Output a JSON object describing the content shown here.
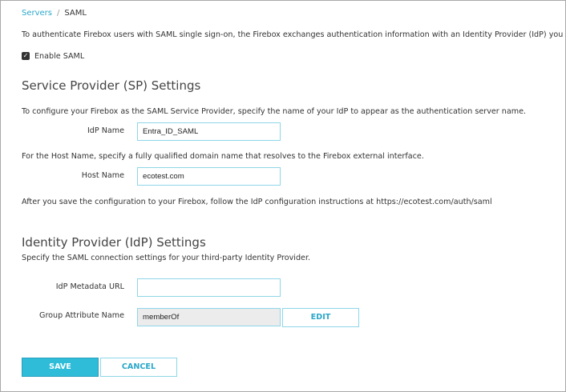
{
  "breadcrumb": {
    "parent": "Servers",
    "separator": "/",
    "current": "SAML"
  },
  "intro": "To authenticate Firebox users with SAML single sign-on, the Firebox exchanges authentication information with an Identity Provider (IdP) you specify.",
  "enable_saml": {
    "label": "Enable SAML",
    "checked": true
  },
  "sp": {
    "title": "Service Provider (SP) Settings",
    "desc": "To configure your Firebox as the SAML Service Provider, specify the name of your IdP to appear as the authentication server name.",
    "idp_name_label": "IdP Name",
    "idp_name_value": "Entra_ID_SAML",
    "host_desc": "For the Host Name, specify a fully qualified domain name that resolves to the Firebox external interface.",
    "host_label": "Host Name",
    "host_value": "ecotest.com",
    "after_save": "After you save the configuration to your Firebox, follow the IdP configuration instructions at https://ecotest.com/auth/saml"
  },
  "idp": {
    "title": "Identity Provider (IdP) Settings",
    "desc": "Specify the SAML connection settings for your third-party Identity Provider.",
    "metadata_label": "IdP Metadata URL",
    "metadata_value": "",
    "group_label": "Group Attribute Name",
    "group_value": "memberOf",
    "edit_label": "EDIT"
  },
  "actions": {
    "save": "SAVE",
    "cancel": "CANCEL"
  }
}
